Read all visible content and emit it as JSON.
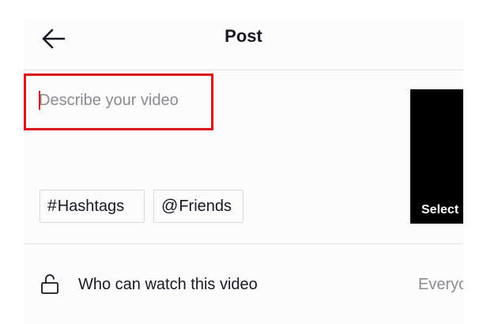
{
  "header": {
    "title": "Post",
    "back_icon": "arrow-left-icon"
  },
  "description": {
    "placeholder": "Describe your video",
    "highlight_color": "#e0131b"
  },
  "cover": {
    "label": "Select"
  },
  "chips": [
    {
      "symbol": "#",
      "label": "Hashtags",
      "icon": "hashtag-icon"
    },
    {
      "symbol": "@",
      "label": "Friends",
      "icon": "at-icon"
    }
  ],
  "privacy_row": {
    "icon": "unlock-icon",
    "label": "Who can watch this video",
    "value": "Everyo"
  },
  "colors": {
    "text_primary": "#161823",
    "text_secondary": "#8a8b91",
    "accent": "#e0131b"
  }
}
